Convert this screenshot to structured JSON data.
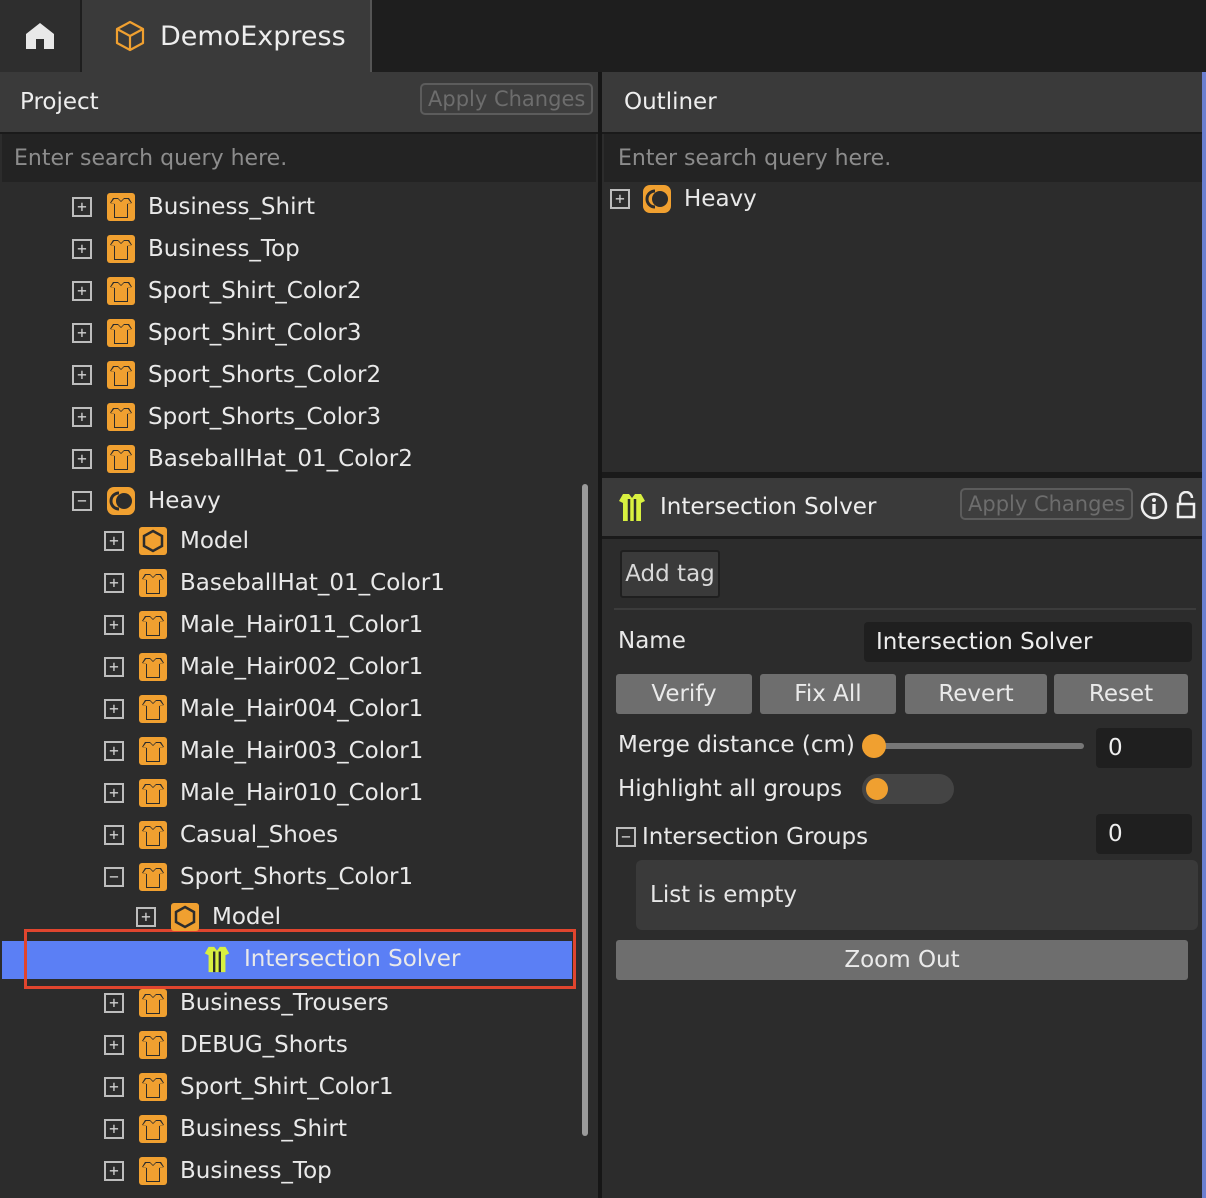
{
  "topbar": {
    "home_icon": "home-icon",
    "project_tab": {
      "icon": "cube-icon",
      "label": "DemoExpress"
    }
  },
  "colors": {
    "accent_orange": "#f0a030",
    "selection_blue": "#5b7ff5",
    "highlight_red": "#e0452e",
    "yellow_green": "#d8f040"
  },
  "project_panel": {
    "title": "Project",
    "apply_label": "Apply Changes",
    "search_placeholder": "Enter search query here.",
    "tree": [
      {
        "label": "Business_Shirt",
        "expander": "+",
        "icon": "shirt-icon"
      },
      {
        "label": "Business_Top",
        "expander": "+",
        "icon": "shirt-icon"
      },
      {
        "label": "Sport_Shirt_Color2",
        "expander": "+",
        "icon": "shirt-icon"
      },
      {
        "label": "Sport_Shirt_Color3",
        "expander": "+",
        "icon": "shirt-icon"
      },
      {
        "label": "Sport_Shorts_Color2",
        "expander": "+",
        "icon": "shirt-icon"
      },
      {
        "label": "Sport_Shorts_Color3",
        "expander": "+",
        "icon": "shirt-icon"
      },
      {
        "label": "BaseballHat_01_Color2",
        "expander": "+",
        "icon": "shirt-icon"
      },
      {
        "label": "Heavy",
        "expander": "−",
        "icon": "avatar-icon"
      },
      {
        "label": "Model",
        "expander": "+",
        "icon": "model-icon"
      },
      {
        "label": "BaseballHat_01_Color1",
        "expander": "+",
        "icon": "shirt-icon"
      },
      {
        "label": "Male_Hair011_Color1",
        "expander": "+",
        "icon": "shirt-icon"
      },
      {
        "label": "Male_Hair002_Color1",
        "expander": "+",
        "icon": "shirt-icon"
      },
      {
        "label": "Male_Hair004_Color1",
        "expander": "+",
        "icon": "shirt-icon"
      },
      {
        "label": "Male_Hair003_Color1",
        "expander": "+",
        "icon": "shirt-icon"
      },
      {
        "label": "Male_Hair010_Color1",
        "expander": "+",
        "icon": "shirt-icon"
      },
      {
        "label": "Casual_Shoes",
        "expander": "+",
        "icon": "shirt-icon"
      },
      {
        "label": "Sport_Shorts_Color1",
        "expander": "−",
        "icon": "shirt-icon"
      },
      {
        "label": "Model",
        "expander": "+",
        "icon": "model-icon"
      },
      {
        "label": "Intersection Solver",
        "expander": "",
        "icon": "solver-icon",
        "selected": true
      },
      {
        "label": "Business_Trousers",
        "expander": "+",
        "icon": "shirt-icon"
      },
      {
        "label": "DEBUG_Shorts",
        "expander": "+",
        "icon": "shirt-icon"
      },
      {
        "label": "Sport_Shirt_Color1",
        "expander": "+",
        "icon": "shirt-icon"
      },
      {
        "label": "Business_Shirt",
        "expander": "+",
        "icon": "shirt-icon"
      },
      {
        "label": "Business_Top",
        "expander": "+",
        "icon": "shirt-icon"
      }
    ]
  },
  "outliner": {
    "title": "Outliner",
    "search_placeholder": "Enter search query here.",
    "items": [
      {
        "label": "Heavy",
        "expander": "+",
        "icon": "avatar-icon"
      }
    ]
  },
  "inspector": {
    "title": "Intersection Solver",
    "apply_label": "Apply Changes",
    "info_icon": "info-icon",
    "lock_icon": "unlock-icon",
    "add_tag_label": "Add tag",
    "name_label": "Name",
    "name_value": "Intersection Solver",
    "buttons": {
      "verify": "Verify",
      "fix_all": "Fix All",
      "revert": "Revert",
      "reset": "Reset"
    },
    "merge_distance_label": "Merge distance (cm)",
    "merge_distance_value": "0",
    "merge_slider_fraction": 0,
    "highlight_label": "Highlight all groups",
    "highlight_on": false,
    "groups_label": "Intersection Groups",
    "groups_count": "0",
    "groups_expander": "−",
    "empty_label": "List is empty",
    "zoom_out_label": "Zoom Out"
  }
}
